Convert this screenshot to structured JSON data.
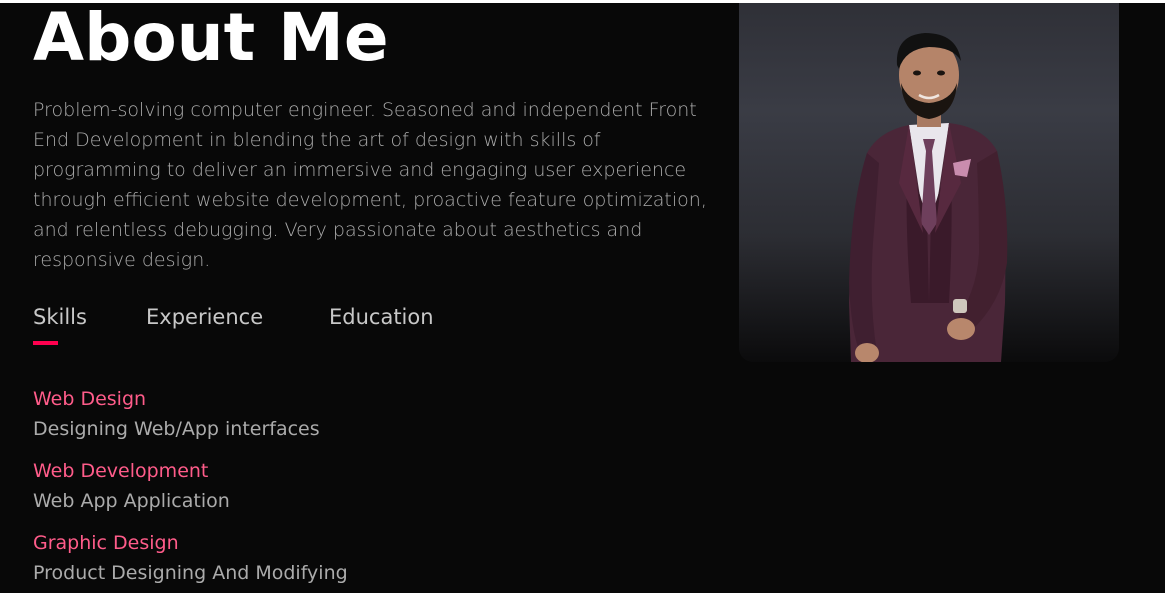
{
  "about": {
    "title": "About Me",
    "bio": "Problem-solving computer engineer. Seasoned and independent Front End Development in blending the art of design with skills of programming to deliver an immersive and engaging user experience through efficient website development, proactive feature optimization, and relentless debugging. Very passionate about aesthetics and responsive design."
  },
  "tabs": [
    {
      "label": "Skills",
      "active": true
    },
    {
      "label": "Experience",
      "active": false
    },
    {
      "label": "Education",
      "active": false
    }
  ],
  "skills": [
    {
      "title": "Web Design",
      "description": "Designing Web/App interfaces"
    },
    {
      "title": "Web Development",
      "description": "Web App Application"
    },
    {
      "title": "Graphic Design",
      "description": "Product Designing And Modifying"
    }
  ],
  "colors": {
    "background": "#080808",
    "accent": "#ff004f",
    "skill_title": "#ff5c8a",
    "text": "#ababab",
    "heading": "#ffffff"
  }
}
